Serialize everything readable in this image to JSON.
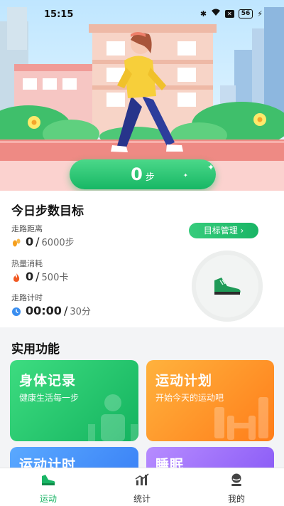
{
  "status_bar": {
    "time": "15:15",
    "battery": "56"
  },
  "hero": {
    "steps_value": "0",
    "steps_unit": "步"
  },
  "goal_card": {
    "title": "今日步数目标",
    "manage_button": "目标管理 ›",
    "distance": {
      "label": "走路距离",
      "current": "0",
      "separator": "/",
      "target": "6000步"
    },
    "calories": {
      "label": "热量消耗",
      "current": "0",
      "separator": "/",
      "target": "500卡"
    },
    "time": {
      "label": "走路计时",
      "current": "00:00",
      "separator": "/",
      "target": "30分"
    }
  },
  "tools": {
    "section_title": "实用功能",
    "body_record": {
      "title": "身体记录",
      "subtitle": "健康生活每一步"
    },
    "sport_plan": {
      "title": "运动计划",
      "subtitle": "开始今天的运动吧"
    },
    "sport_timer": {
      "title": "运动计时"
    },
    "sleep": {
      "title": "睡眠"
    }
  },
  "tabbar": {
    "sport": "运动",
    "stats": "统计",
    "mine": "我的"
  },
  "colors": {
    "accent": "#19b565",
    "orange": "#ff7d1a",
    "blue": "#3b82f6",
    "purple": "#8b5cf6"
  },
  "icons": [
    "bluetooth-icon",
    "wifi-icon",
    "sim-icon",
    "battery-icon",
    "charging-icon",
    "footprint-icon",
    "flame-icon",
    "clock-icon",
    "sneaker-icon",
    "stats-icon",
    "profile-icon"
  ]
}
